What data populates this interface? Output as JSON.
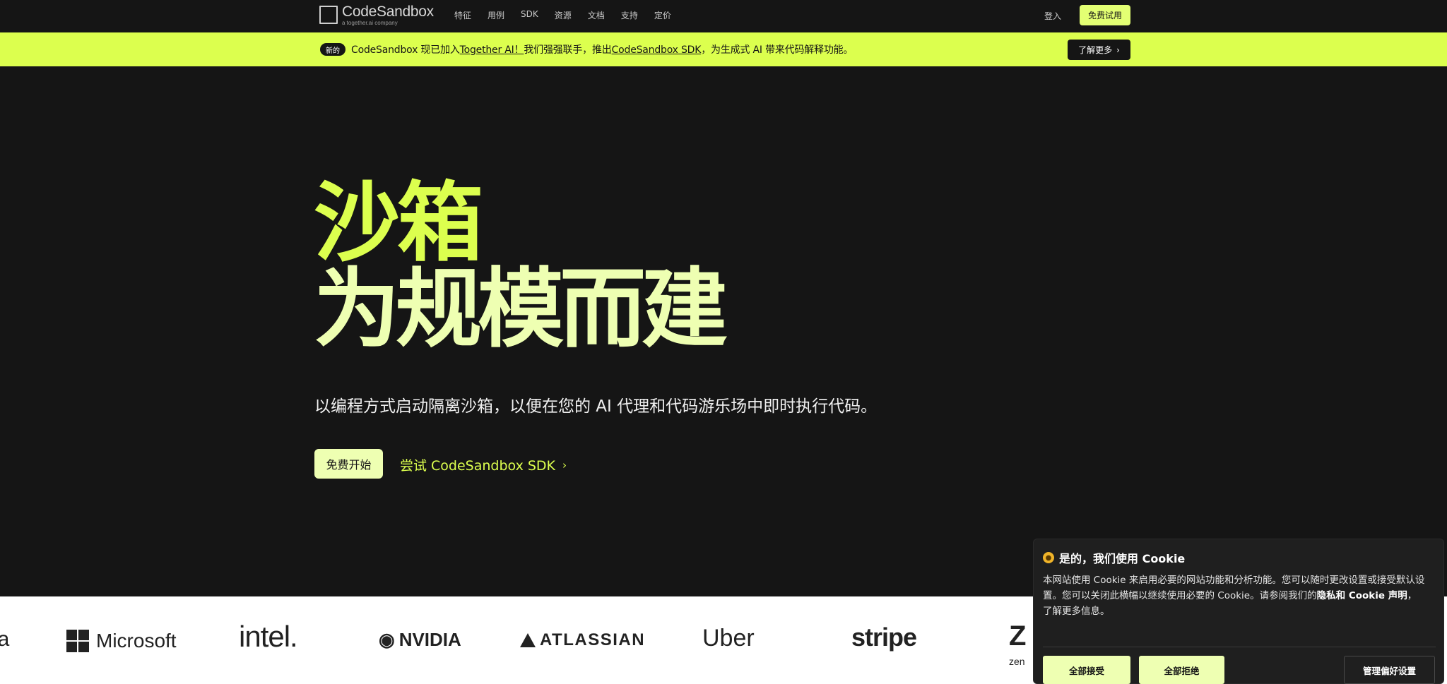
{
  "nav": {
    "logo_name": "CodeSandbox",
    "logo_sub": "a together.ai company",
    "links": [
      "特征",
      "用例",
      "SDK",
      "资源",
      "文档",
      "支持",
      "定价"
    ],
    "login": "登入",
    "trial_button": "免费试用"
  },
  "announcement": {
    "badge": "新的",
    "text_prefix": "CodeSandbox 现已加入",
    "link1": "Together AI！",
    "text_mid": "我们强强联手，推出",
    "link2": "CodeSandbox SDK",
    "text_suffix": "，为生成式 AI 带来代码解释功能。",
    "learn_more": "了解更多",
    "colors": {
      "background": "#dcff4e"
    }
  },
  "hero": {
    "line1": "沙箱",
    "line2": "为规模而建",
    "subtitle": "以编程方式启动隔离沙箱，以便在您的 AI 代理和代码游乐场中即时执行代码。",
    "start_button": "免费开始",
    "sdk_link": "尝试 CodeSandbox SDK",
    "colors": {
      "accent": "#dcff4e",
      "accent_light": "#eeffb2"
    }
  },
  "logos": {
    "cut": "ia",
    "microsoft": "Microsoft",
    "intel": "intel.",
    "nvidia": "NVIDIA",
    "atlassian": "ATLASSIAN",
    "uber": "Uber",
    "stripe": "stripe",
    "zen": "Z",
    "zen_small": "zen"
  },
  "cookie": {
    "title": "是的，我们使用 Cookie",
    "body_part1": "本网站使用 Cookie 来启用必要的网站功能和分析功能。您可以随时更改设置或接受默认设置。您可以关闭此横幅以继续使用必要的 Cookie。请参阅我们的",
    "body_bold": "隐私和 Cookie 声明",
    "body_part2": "，",
    "body_line2": "了解更多信息。",
    "accept_all": "全部接受",
    "reject_all": "全部拒绝",
    "manage": "管理偏好设置"
  }
}
